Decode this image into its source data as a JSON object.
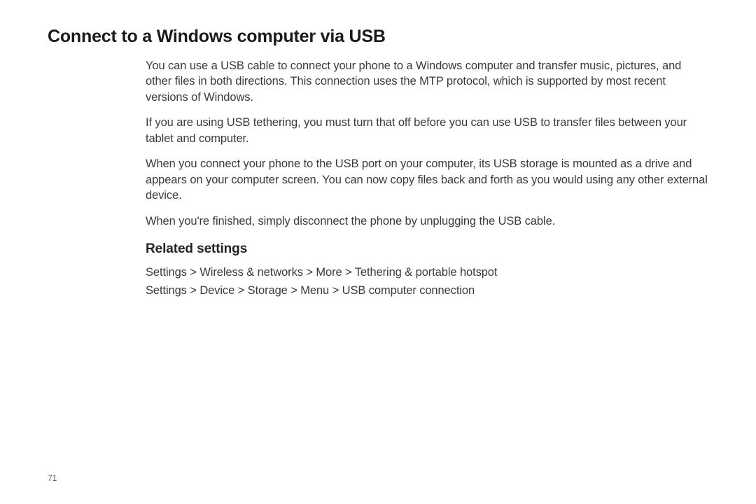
{
  "title": "Connect to a Windows computer via USB",
  "paragraphs": [
    "You can use a USB cable to connect your phone to a Windows computer and transfer music, pictures, and other files in both directions. This connection uses the MTP protocol, which is supported by most recent versions of Windows.",
    "If you are using USB tethering, you must turn that off before you can use USB to transfer files between your tablet and computer.",
    "When you connect your phone to the USB port on your computer, its USB storage is mounted as a drive and appears on your computer screen. You can now copy files back and forth as you would using any other external device.",
    "When you're finished, simply disconnect the phone by unplugging the USB cable."
  ],
  "subheading": "Related settings",
  "settings": [
    "Settings > Wireless & networks > More > Tethering & portable hotspot",
    "Settings > Device > Storage > Menu > USB computer connection"
  ],
  "page_number": "71"
}
